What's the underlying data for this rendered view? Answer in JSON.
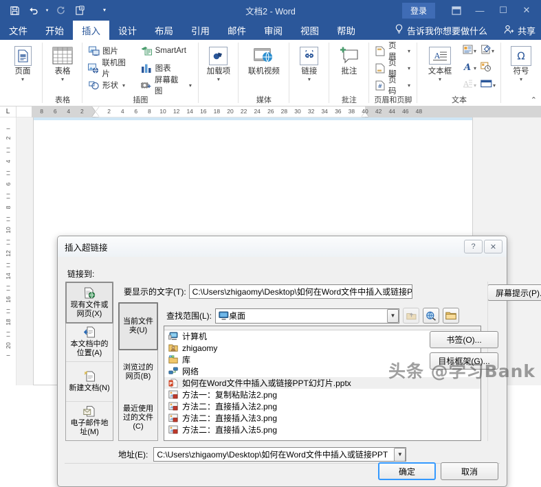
{
  "titlebar": {
    "doc_title": "文档2  -  Word",
    "signin": "登录",
    "qat": [
      {
        "name": "save",
        "glyph": "save-icon"
      },
      {
        "name": "undo",
        "glyph": "undo-icon"
      },
      {
        "name": "redo",
        "glyph": "redo-icon"
      },
      {
        "name": "touch-mode",
        "glyph": "touch-mode-icon"
      },
      {
        "name": "customize-qat",
        "glyph": "chevron-down-icon"
      }
    ],
    "ribbon_display": "⊞",
    "minimize": "—",
    "maximize": "☐",
    "close": "✕",
    "accent": "#2b579a"
  },
  "tabs": {
    "items": [
      {
        "label": "文件",
        "active": false
      },
      {
        "label": "开始",
        "active": false
      },
      {
        "label": "插入",
        "active": true
      },
      {
        "label": "设计",
        "active": false
      },
      {
        "label": "布局",
        "active": false
      },
      {
        "label": "引用",
        "active": false
      },
      {
        "label": "邮件",
        "active": false
      },
      {
        "label": "审阅",
        "active": false
      },
      {
        "label": "视图",
        "active": false
      },
      {
        "label": "帮助",
        "active": false
      }
    ],
    "tell_me": "告诉我你想要做什么",
    "share": "共享"
  },
  "ribbon": {
    "groups": [
      {
        "label": "",
        "big": [
          {
            "label": "页面",
            "caret": "▾"
          }
        ]
      },
      {
        "label": "表格",
        "big": [
          {
            "label": "表格",
            "caret": "▾"
          }
        ]
      },
      {
        "label": "插图",
        "small_left": [
          {
            "label": "图片",
            "caret": ""
          },
          {
            "label": "联机图片",
            "caret": ""
          },
          {
            "label": "形状",
            "caret": "▾"
          }
        ],
        "small_right": [
          {
            "label": "SmartArt",
            "caret": ""
          },
          {
            "label": "图表",
            "caret": ""
          },
          {
            "label": "屏幕截图",
            "caret": "▾"
          }
        ]
      },
      {
        "label": "",
        "big": [
          {
            "label": "加载项",
            "caret": "▾"
          }
        ]
      },
      {
        "label": "媒体",
        "big": [
          {
            "label": "联机视频",
            "caret": ""
          }
        ]
      },
      {
        "label": "",
        "big": [
          {
            "label": "链接",
            "caret": "▾"
          }
        ]
      },
      {
        "label": "批注",
        "big": [
          {
            "label": "批注",
            "caret": ""
          }
        ]
      },
      {
        "label": "页眉和页脚",
        "small_left": [
          {
            "label": "页眉",
            "caret": "▾"
          },
          {
            "label": "页脚",
            "caret": "▾"
          },
          {
            "label": "页码",
            "caret": "▾"
          }
        ]
      },
      {
        "label": "文本",
        "big": [
          {
            "label": "文本框",
            "caret": "▾"
          }
        ],
        "mini": [
          {
            "name": "quick-parts",
            "caret": "▾"
          },
          {
            "name": "signature-line",
            "caret": "▾"
          },
          {
            "name": "wordart",
            "caret": "▾"
          },
          {
            "name": "date-time",
            "caret": ""
          },
          {
            "name": "drop-cap",
            "caret": "▾"
          },
          {
            "name": "object",
            "caret": "▾"
          }
        ]
      },
      {
        "label": "",
        "big": [
          {
            "label": "符号",
            "caret": "▾"
          }
        ]
      }
    ],
    "collapse": "⌃"
  },
  "ruler": {
    "tabstop_glyph": "L",
    "h_labels": [
      "8",
      "6",
      "4",
      "2",
      "2",
      "4",
      "6",
      "8",
      "10",
      "12",
      "14",
      "16",
      "18",
      "20",
      "22",
      "24",
      "26",
      "28",
      "30",
      "32",
      "34",
      "36",
      "38",
      "40",
      "42",
      "44",
      "46",
      "48"
    ],
    "v_labels": [
      "2",
      "4",
      "6",
      "8",
      "10",
      "12",
      "14",
      "16",
      "18",
      "20"
    ]
  },
  "dialog": {
    "title": "插入超链接",
    "help_btn": "?",
    "close_btn": "✕",
    "link_to_label": "链接到:",
    "rail": [
      {
        "label": "现有文件或网页(X)",
        "underline": "X",
        "selected": true,
        "icon": "existing-file-icon"
      },
      {
        "label": "本文档中的位置(A)",
        "underline": "A",
        "selected": false,
        "icon": "place-in-document-icon"
      },
      {
        "label": "新建文档(N)",
        "underline": "N",
        "selected": false,
        "icon": "new-document-icon"
      },
      {
        "label": "电子邮件地址(M)",
        "underline": "M",
        "selected": false,
        "icon": "email-address-icon"
      }
    ],
    "display_text_label": "要显示的文字(T):",
    "display_text_value": "C:\\Users\\zhigaomy\\Desktop\\如何在Word文件中插入或链接PP",
    "screentip_btn": "屏幕提示(P)...",
    "lookin_label": "查找范围(L):",
    "lookin_value": "桌面",
    "lookin_icon": "desktop-icon",
    "up_one_level": "up-one-level-icon",
    "browse_web": "browse-web-icon",
    "browse_file": "browse-file-icon",
    "subrail": [
      {
        "label": "当前文件夹(U)",
        "selected": true
      },
      {
        "label": "浏览过的网页(B)",
        "selected": false
      },
      {
        "label": "最近使用过的文件(C)",
        "selected": false
      }
    ],
    "files": [
      {
        "name": "计算机",
        "icon": "computer-icon",
        "selected": false
      },
      {
        "name": "zhigaomy",
        "icon": "user-folder-icon",
        "selected": false
      },
      {
        "name": "库",
        "icon": "library-icon",
        "selected": false
      },
      {
        "name": "网络",
        "icon": "network-icon",
        "selected": false
      },
      {
        "name": "如何在Word文件中插入或链接PPT幻灯片.pptx",
        "icon": "powerpoint-icon",
        "selected": true
      },
      {
        "name": "方法一：复制粘贴法2.png",
        "icon": "png-icon",
        "selected": false
      },
      {
        "name": "方法二：直接插入法2.png",
        "icon": "png-icon",
        "selected": false
      },
      {
        "name": "方法二：直接插入法3.png",
        "icon": "png-icon",
        "selected": false
      },
      {
        "name": "方法二：直接插入法5.png",
        "icon": "png-icon",
        "selected": false
      }
    ],
    "bookmark_btn": "书签(O)...",
    "target_frame_btn": "目标框架(G)...",
    "address_label": "地址(E):",
    "address_value": "C:\\Users\\zhigaomy\\Desktop\\如何在Word文件中插入或链接PPT",
    "ok_btn": "确定",
    "cancel_btn": "取消"
  },
  "watermark": "头条 @学习Bank"
}
